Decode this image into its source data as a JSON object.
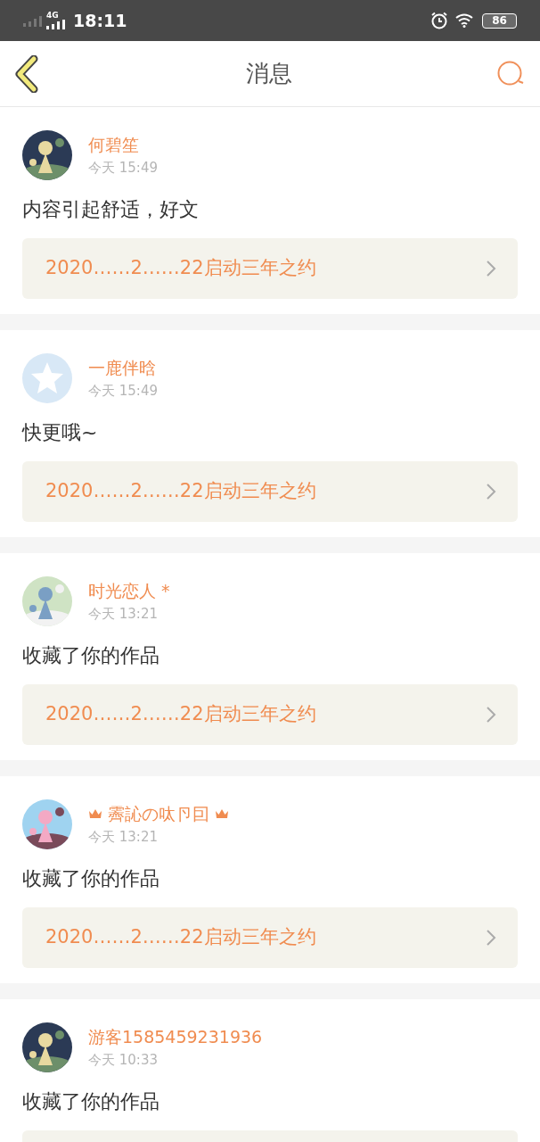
{
  "status_bar": {
    "network": "4G",
    "time": "18:11",
    "battery": "86"
  },
  "header": {
    "title": "消息"
  },
  "messages": [
    {
      "name": "何碧笙",
      "crowned": false,
      "time": "今天 15:49",
      "content": "内容引起舒适，好文",
      "link": "2020……2……22启动三年之约"
    },
    {
      "avatar": {
        "kind": "default"
      },
      "name": "一鹿伴晗",
      "crowned": false,
      "time": "今天 15:49",
      "content": "快更哦~",
      "link": "2020……2……22启动三年之约"
    },
    {
      "name": "时光恋人 *",
      "crowned": false,
      "time": "今天 13:21",
      "content": "收藏了你的作品",
      "link": "2020……2……22启动三年之约"
    },
    {
      "name": "霽訫の呔卪囙",
      "crowned": true,
      "time": "今天 13:21",
      "content": "收藏了你的作品",
      "link": "2020……2……22启动三年之约"
    },
    {
      "name": "游客1585459231936",
      "crowned": false,
      "time": "今天 10:33",
      "content": "收藏了你的作品"
    }
  ]
}
